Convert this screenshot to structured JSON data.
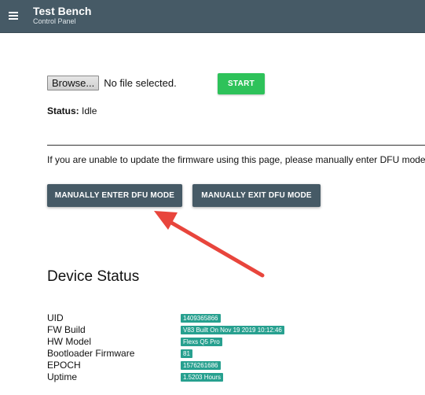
{
  "header": {
    "title": "Test Bench",
    "subtitle": "Control Panel"
  },
  "upload": {
    "browse_label": "Browse...",
    "file_status": "No file selected.",
    "start_label": "START"
  },
  "status": {
    "label": "Status:",
    "value": "Idle"
  },
  "dfu": {
    "note": "If you are unable to update the firmware using this page, please manually enter DFU mode",
    "enter_label": "MANUALLY ENTER DFU MODE",
    "exit_label": "MANUALLY EXIT DFU MODE"
  },
  "device_status": {
    "title": "Device Status",
    "rows": [
      {
        "label": "UID",
        "value": "1409365866"
      },
      {
        "label": "FW Build",
        "value": "V83 Built On Nov 19 2019 10:12:46"
      },
      {
        "label": "HW Model",
        "value": "Flexs Q5 Pro"
      },
      {
        "label": "Bootloader Firmware",
        "value": "81"
      },
      {
        "label": "EPOCH",
        "value": "1576261686"
      },
      {
        "label": "Uptime",
        "value": "1.5203 Hours"
      }
    ]
  },
  "colors": {
    "header_bg": "#465a66",
    "start_bg": "#2ec25a",
    "badge_bg": "#27a08f",
    "annotation_arrow": "#e8453c"
  },
  "icons": {
    "menu": "hamburger-menu-icon",
    "annotation": "arrow-annotation"
  }
}
